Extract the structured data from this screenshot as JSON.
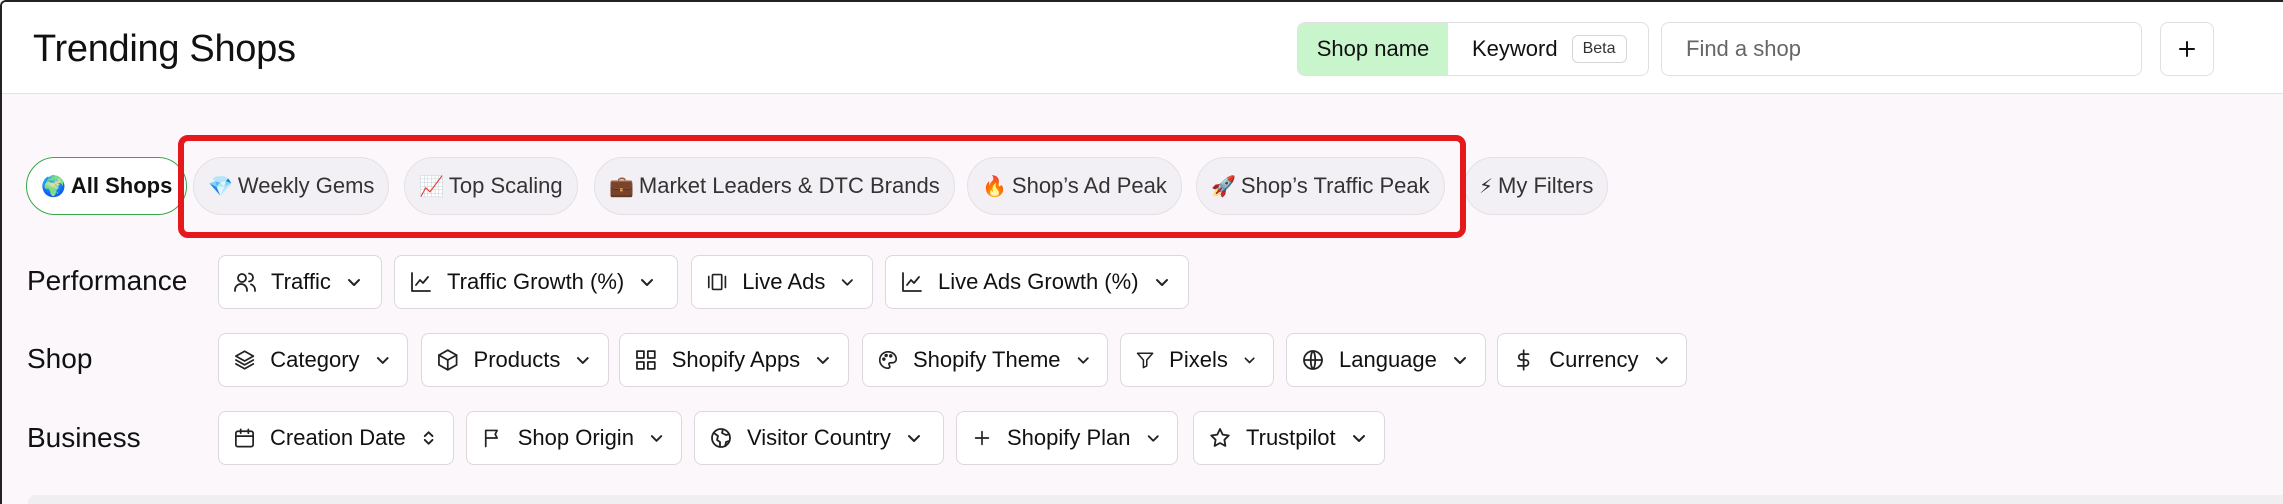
{
  "header": {
    "title": "Trending Shops",
    "search_mode": {
      "active": "Shop name",
      "keyword": "Keyword",
      "beta": "Beta"
    },
    "search": {
      "placeholder": "Find a shop"
    },
    "add_icon": "plus-icon"
  },
  "presets": [
    {
      "emoji": "🌍",
      "label": "All Shops",
      "active": true
    },
    {
      "emoji": "💎",
      "label": "Weekly Gems"
    },
    {
      "emoji": "📈",
      "label": "Top Scaling"
    },
    {
      "emoji": "💼",
      "label": "Market Leaders & DTC Brands"
    },
    {
      "emoji": "🔥",
      "label": "Shop’s Ad Peak"
    },
    {
      "emoji": "🚀",
      "label": "Shop’s Traffic Peak"
    },
    {
      "emoji": "⚡",
      "label": "My Filters"
    }
  ],
  "highlight_color": "#e5191b",
  "accent_green": "#c9f5cd",
  "filters": {
    "performance": {
      "label": "Performance",
      "items": [
        {
          "label": "Traffic",
          "icon": "users-icon"
        },
        {
          "label": "Traffic Growth (%)",
          "icon": "line-chart-icon"
        },
        {
          "label": "Live Ads",
          "icon": "carousel-icon"
        },
        {
          "label": "Live Ads Growth (%)",
          "icon": "line-chart-icon"
        }
      ]
    },
    "shop": {
      "label": "Shop",
      "items": [
        {
          "label": "Category",
          "icon": "layers-icon"
        },
        {
          "label": "Products",
          "icon": "box-icon"
        },
        {
          "label": "Shopify Apps",
          "icon": "apps-grid-icon"
        },
        {
          "label": "Shopify Theme",
          "icon": "palette-icon"
        },
        {
          "label": "Pixels",
          "icon": "funnel-icon"
        },
        {
          "label": "Language",
          "icon": "globe-icon"
        },
        {
          "label": "Currency",
          "icon": "dollar-icon"
        }
      ]
    },
    "business": {
      "label": "Business",
      "items": [
        {
          "label": "Creation Date",
          "icon": "calendar-icon"
        },
        {
          "label": "Shop Origin",
          "icon": "flag-icon"
        },
        {
          "label": "Visitor Country",
          "icon": "world-icon"
        },
        {
          "label": "Shopify Plan",
          "icon": "plus-icon"
        },
        {
          "label": "Trustpilot",
          "icon": "star-icon"
        }
      ]
    }
  }
}
